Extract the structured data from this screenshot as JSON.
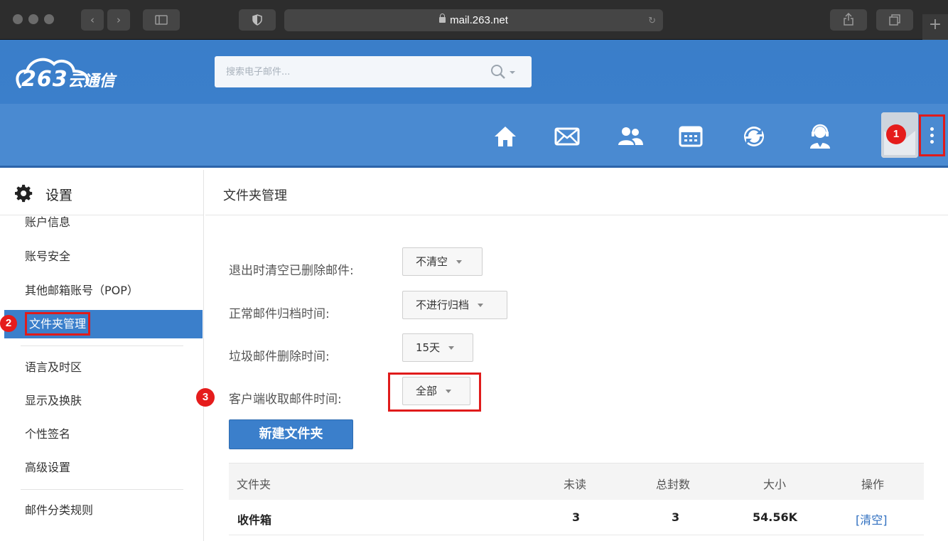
{
  "browser": {
    "url": "mail.263.net"
  },
  "header": {
    "logo_text": "263",
    "logo_cn": "云通信",
    "search_placeholder": "搜索电子邮件..."
  },
  "nav": {
    "icons": [
      "home-icon",
      "mail-icon",
      "contacts-icon",
      "calendar-icon",
      "sync-icon",
      "support-icon"
    ]
  },
  "badges": {
    "b1": "1",
    "b2": "2",
    "b3": "3"
  },
  "sidebar": {
    "title": "设置",
    "items": [
      {
        "label": "账户信息"
      },
      {
        "label": "账号安全"
      },
      {
        "label": "其他邮箱账号（POP）"
      },
      {
        "label": "文件夹管理"
      },
      {
        "label": "语言及时区"
      },
      {
        "label": "显示及换肤"
      },
      {
        "label": "个性签名"
      },
      {
        "label": "高级设置"
      },
      {
        "label": "邮件分类规则"
      }
    ]
  },
  "main": {
    "title": "文件夹管理",
    "settings": [
      {
        "label": "退出时清空已删除邮件:",
        "value": "不清空"
      },
      {
        "label": "正常邮件归档时间:",
        "value": "不进行归档"
      },
      {
        "label": "垃圾邮件删除时间:",
        "value": "15天"
      },
      {
        "label": "客户端收取邮件时间:",
        "value": "全部"
      }
    ],
    "new_folder_button": "新建文件夹",
    "table": {
      "headers": [
        "文件夹",
        "未读",
        "总封数",
        "大小",
        "操作"
      ],
      "rows": [
        {
          "folder": "收件箱",
          "unread": "3",
          "total": "3",
          "size": "54.56K",
          "action": "[清空]"
        }
      ]
    }
  },
  "colors": {
    "accent": "#3b7fcb",
    "highlight": "#e01b1b"
  }
}
